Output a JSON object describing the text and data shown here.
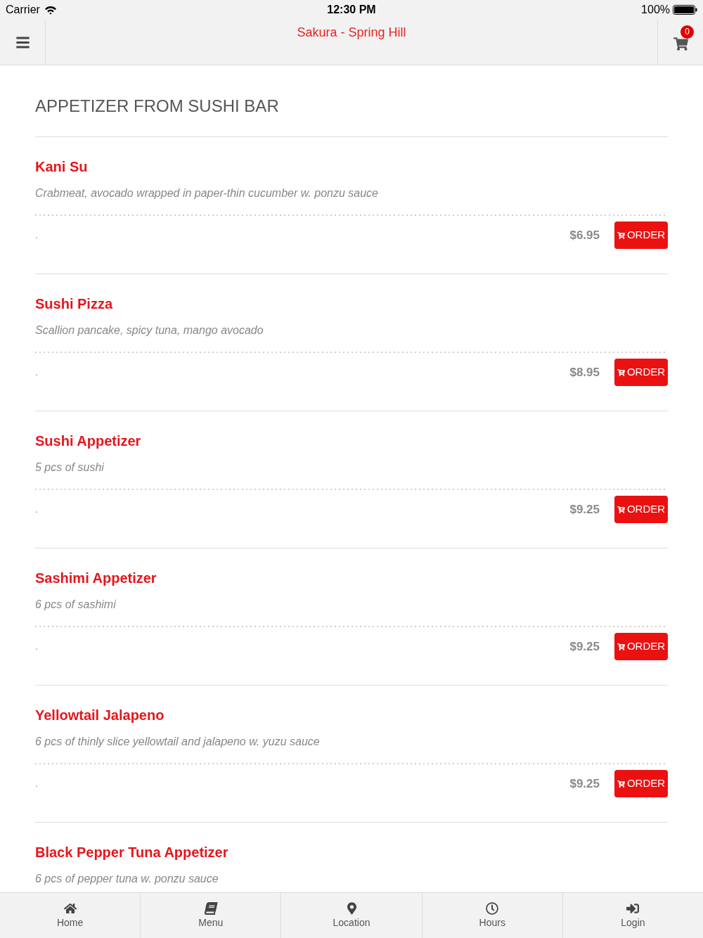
{
  "status_bar": {
    "carrier": "Carrier",
    "time": "12:30 PM",
    "battery": "100%"
  },
  "nav": {
    "title": "Sakura - Spring Hill",
    "cart_count": "0"
  },
  "section": {
    "title": "APPETIZER FROM SUSHI BAR"
  },
  "items": [
    {
      "name": "Kani Su",
      "description": "Crabmeat, avocado wrapped in paper-thin cucumber w. ponzu sauce",
      "note": ".",
      "price": "$6.95",
      "button": "ORDER"
    },
    {
      "name": "Sushi Pizza",
      "description": "Scallion pancake, spicy tuna, mango avocado",
      "note": ".",
      "price": "$8.95",
      "button": "ORDER"
    },
    {
      "name": "Sushi Appetizer",
      "description": "5 pcs of sushi",
      "note": ".",
      "price": "$9.25",
      "button": "ORDER"
    },
    {
      "name": "Sashimi Appetizer",
      "description": "6 pcs of sashimi",
      "note": ".",
      "price": "$9.25",
      "button": "ORDER"
    },
    {
      "name": "Yellowtail Jalapeno",
      "description": "6 pcs of thinly slice yellowtail and jalapeno w. yuzu sauce",
      "note": ".",
      "price": "$9.25",
      "button": "ORDER"
    },
    {
      "name": "Black Pepper Tuna Appetizer",
      "description": "6 pcs of pepper tuna w. ponzu sauce"
    }
  ],
  "tab_bar": [
    {
      "label": "Home",
      "kind": "home"
    },
    {
      "label": "Menu",
      "kind": "menu"
    },
    {
      "label": "Location",
      "kind": "location"
    },
    {
      "label": "Hours",
      "kind": "hours"
    },
    {
      "label": "Login",
      "kind": "login"
    }
  ]
}
